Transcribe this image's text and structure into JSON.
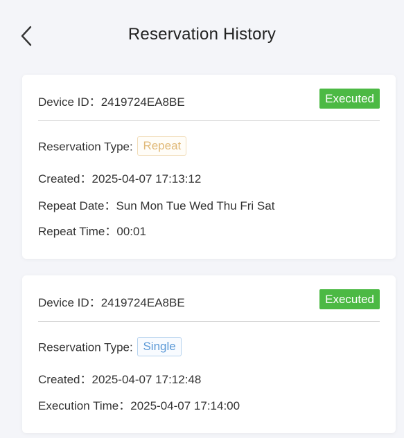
{
  "header": {
    "title": "Reservation History"
  },
  "reservations": [
    {
      "device_id_label": "Device ID：",
      "device_id": "2419724EA8BE",
      "status": "Executed",
      "type_label": "Reservation Type:",
      "type": "Repeat",
      "created_label": "Created：",
      "created": "2025-04-07 17:13:12",
      "repeat_date_label": "Repeat Date：",
      "repeat_date": "Sun Mon Tue Wed Thu Fri Sat",
      "repeat_time_label": "Repeat Time：",
      "repeat_time": "00:01"
    },
    {
      "device_id_label": "Device ID：",
      "device_id": "2419724EA8BE",
      "status": "Executed",
      "type_label": "Reservation Type:",
      "type": "Single",
      "created_label": "Created：",
      "created": "2025-04-07 17:12:48",
      "execution_time_label": "Execution Time：",
      "execution_time": "2025-04-07 17:14:00"
    }
  ],
  "colors": {
    "background": "#f4f5f9",
    "executed_badge": "#4cb944",
    "repeat_badge_text": "#e0b978",
    "single_badge_text": "#5a98d6"
  },
  "icons": {
    "back": "chevron-left-icon"
  }
}
